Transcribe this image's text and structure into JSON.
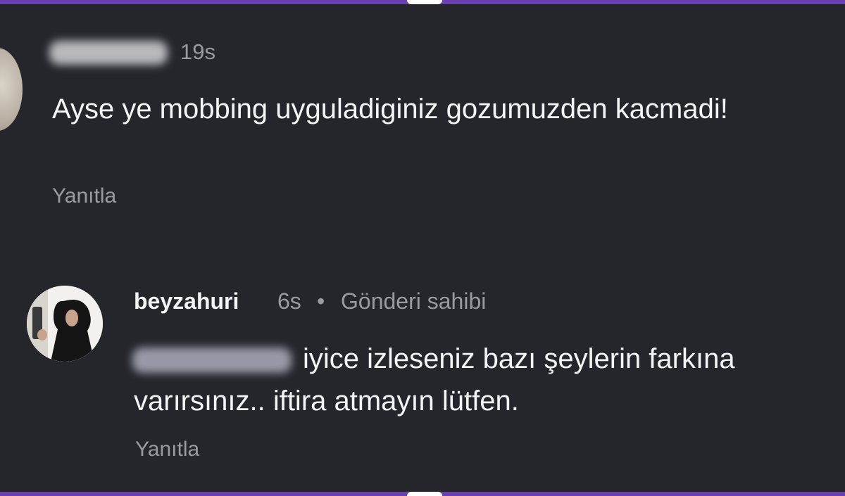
{
  "comments": [
    {
      "time": "19s",
      "text": "Ayse ye mobbing uyguladiginiz gozumuzden kacmadi!",
      "reply_label": "Yanıtla"
    },
    {
      "username": "beyzahuri",
      "time": "6s",
      "separator": "•",
      "author_badge": "Gönderi sahibi",
      "text_line1": "iyice izleseniz bazı şeylerin farkına",
      "text_line2": "varırsınız.. iftira atmayın lütfen.",
      "reply_label": "Yanıtla"
    }
  ],
  "colors": {
    "background": "#25262c",
    "edge_accent": "#6a3fb3",
    "primary_text": "#f4f4f4",
    "secondary_text": "#9a9aa0"
  }
}
